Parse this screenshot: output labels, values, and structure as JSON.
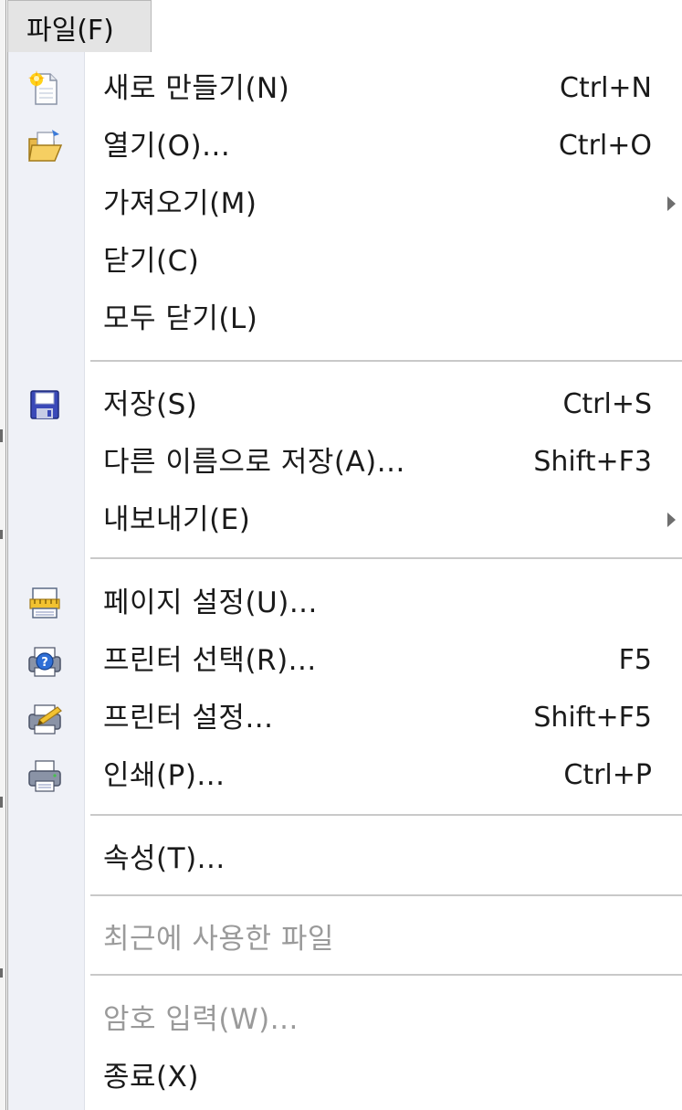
{
  "menubar": {
    "file_label": "파일(F)"
  },
  "menu": {
    "items": [
      {
        "label": "새로 만들기(N)",
        "shortcut": "Ctrl+N",
        "icon": "new-document-icon"
      },
      {
        "label": "열기(O)...",
        "shortcut": "Ctrl+O",
        "icon": "open-folder-icon"
      },
      {
        "label": "가져오기(M)",
        "submenu": true
      },
      {
        "label": "닫기(C)"
      },
      {
        "label": "모두 닫기(L)"
      },
      {
        "label": "저장(S)",
        "shortcut": "Ctrl+S",
        "icon": "save-icon"
      },
      {
        "label": "다른 이름으로 저장(A)...",
        "shortcut": "Shift+F3"
      },
      {
        "label": "내보내기(E)",
        "submenu": true
      },
      {
        "label": "페이지 설정(U)...",
        "icon": "page-setup-icon"
      },
      {
        "label": "프린터 선택(R)...",
        "shortcut": "F5",
        "icon": "printer-select-icon"
      },
      {
        "label": "프린터 설정...",
        "shortcut": "Shift+F5",
        "icon": "printer-settings-icon"
      },
      {
        "label": "인쇄(P)...",
        "shortcut": "Ctrl+P",
        "icon": "print-icon"
      },
      {
        "label": "속성(T)..."
      },
      {
        "label": "최근에 사용한 파일",
        "disabled": true
      },
      {
        "label": "암호 입력(W)...",
        "disabled": true
      },
      {
        "label": "종료(X)"
      }
    ]
  },
  "colors": {
    "icon_gutter": "#eff1f7",
    "disabled_text": "#9a9a9a",
    "separator": "#c9c9c9"
  }
}
